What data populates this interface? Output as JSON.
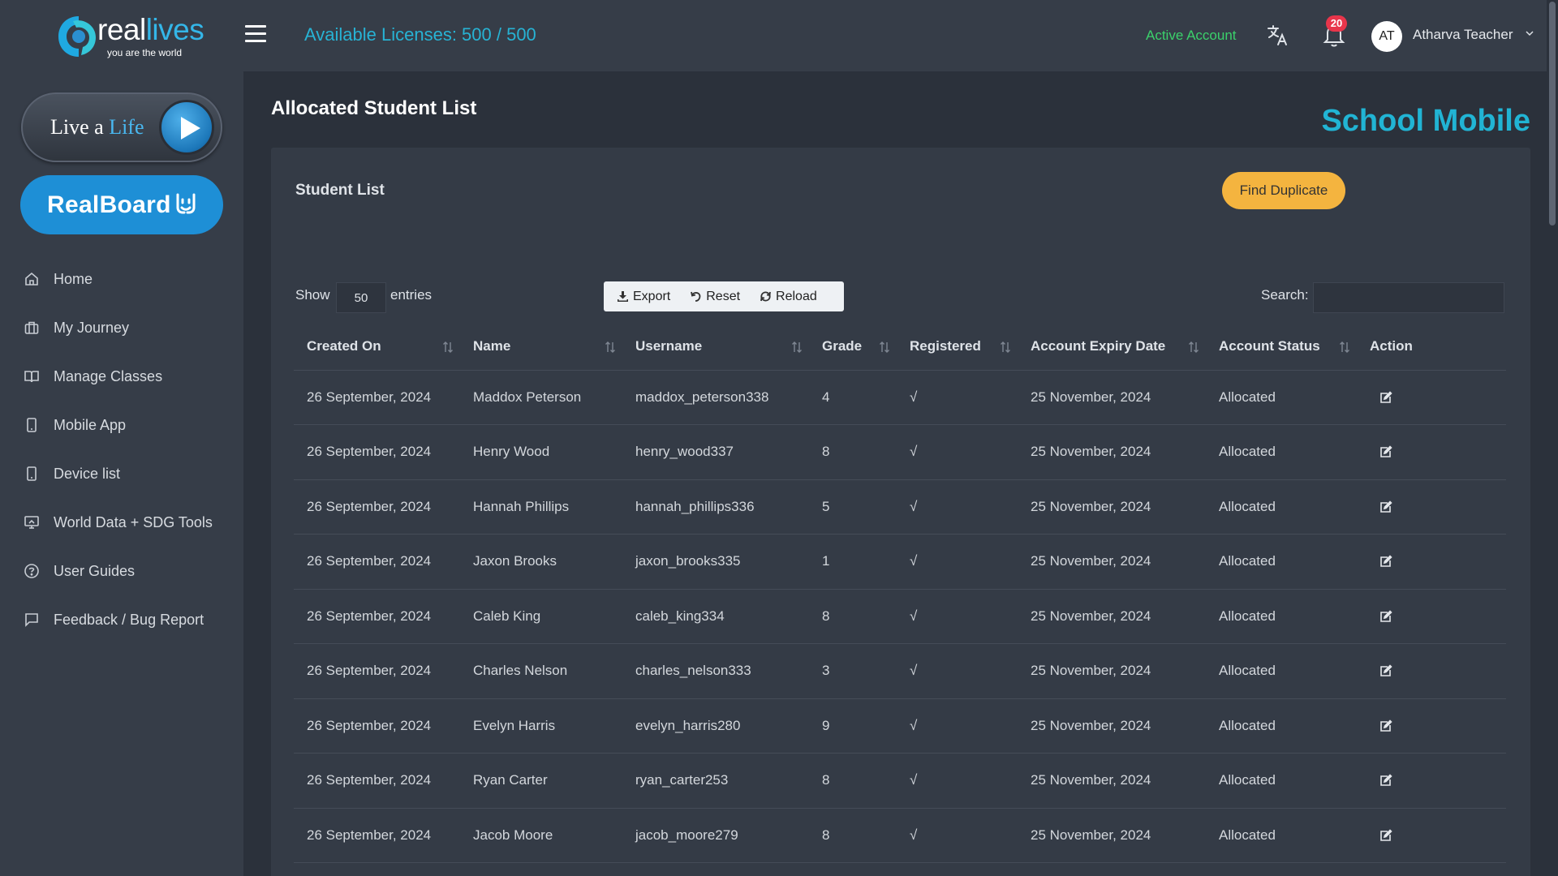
{
  "brand": {
    "logo_text_a": "real",
    "logo_text_b": "lives",
    "tagline": "you are the world"
  },
  "sidebar": {
    "live_a_life": {
      "prefix": "Live a ",
      "highlight": "Life"
    },
    "realboard_label": "RealBoard",
    "items": [
      {
        "label": "Home",
        "icon": "home-icon"
      },
      {
        "label": "My Journey",
        "icon": "briefcase-icon"
      },
      {
        "label": "Manage Classes",
        "icon": "book-icon"
      },
      {
        "label": "Mobile App",
        "icon": "mobile-icon"
      },
      {
        "label": "Device list",
        "icon": "device-icon"
      },
      {
        "label": "World Data + SDG Tools",
        "icon": "monitor-icon"
      },
      {
        "label": "User Guides",
        "icon": "help-circle-icon"
      },
      {
        "label": "Feedback / Bug Report",
        "icon": "message-icon"
      }
    ]
  },
  "topbar": {
    "licenses": "Available Licenses: 500 / 500",
    "account_status": "Active Account",
    "notification_count": "20",
    "avatar_initials": "AT",
    "user_name": "Atharva Teacher"
  },
  "page": {
    "title": "Allocated Student List",
    "badge": "School Mobile"
  },
  "card": {
    "title": "Student List",
    "find_duplicate": "Find Duplicate",
    "show_label": "Show",
    "show_value": "50",
    "entries_label": "entries",
    "export": "Export",
    "reset": "Reset",
    "reload": "Reload",
    "search_label": "Search:"
  },
  "table": {
    "columns": [
      "Created On",
      "Name",
      "Username",
      "Grade",
      "Registered",
      "Account Expiry Date",
      "Account Status",
      "Action"
    ],
    "rows": [
      [
        "26 September, 2024",
        "Maddox Peterson",
        "maddox_peterson338",
        "4",
        "√",
        "25 November, 2024",
        "Allocated"
      ],
      [
        "26 September, 2024",
        "Henry Wood",
        "henry_wood337",
        "8",
        "√",
        "25 November, 2024",
        "Allocated"
      ],
      [
        "26 September, 2024",
        "Hannah Phillips",
        "hannah_phillips336",
        "5",
        "√",
        "25 November, 2024",
        "Allocated"
      ],
      [
        "26 September, 2024",
        "Jaxon Brooks",
        "jaxon_brooks335",
        "1",
        "√",
        "25 November, 2024",
        "Allocated"
      ],
      [
        "26 September, 2024",
        "Caleb King",
        "caleb_king334",
        "8",
        "√",
        "25 November, 2024",
        "Allocated"
      ],
      [
        "26 September, 2024",
        "Charles Nelson",
        "charles_nelson333",
        "3",
        "√",
        "25 November, 2024",
        "Allocated"
      ],
      [
        "26 September, 2024",
        "Evelyn Harris",
        "evelyn_harris280",
        "9",
        "√",
        "25 November, 2024",
        "Allocated"
      ],
      [
        "26 September, 2024",
        "Ryan Carter",
        "ryan_carter253",
        "8",
        "√",
        "25 November, 2024",
        "Allocated"
      ],
      [
        "26 September, 2024",
        "Jacob Moore",
        "jacob_moore279",
        "8",
        "√",
        "25 November, 2024",
        "Allocated"
      ]
    ]
  },
  "colors": {
    "accent": "#21b4d4",
    "active_green": "#3bd16b",
    "find_duplicate_bg": "#f4b43f",
    "realboard_bg": "#1e8fd6",
    "badge_red": "#e8354b"
  }
}
